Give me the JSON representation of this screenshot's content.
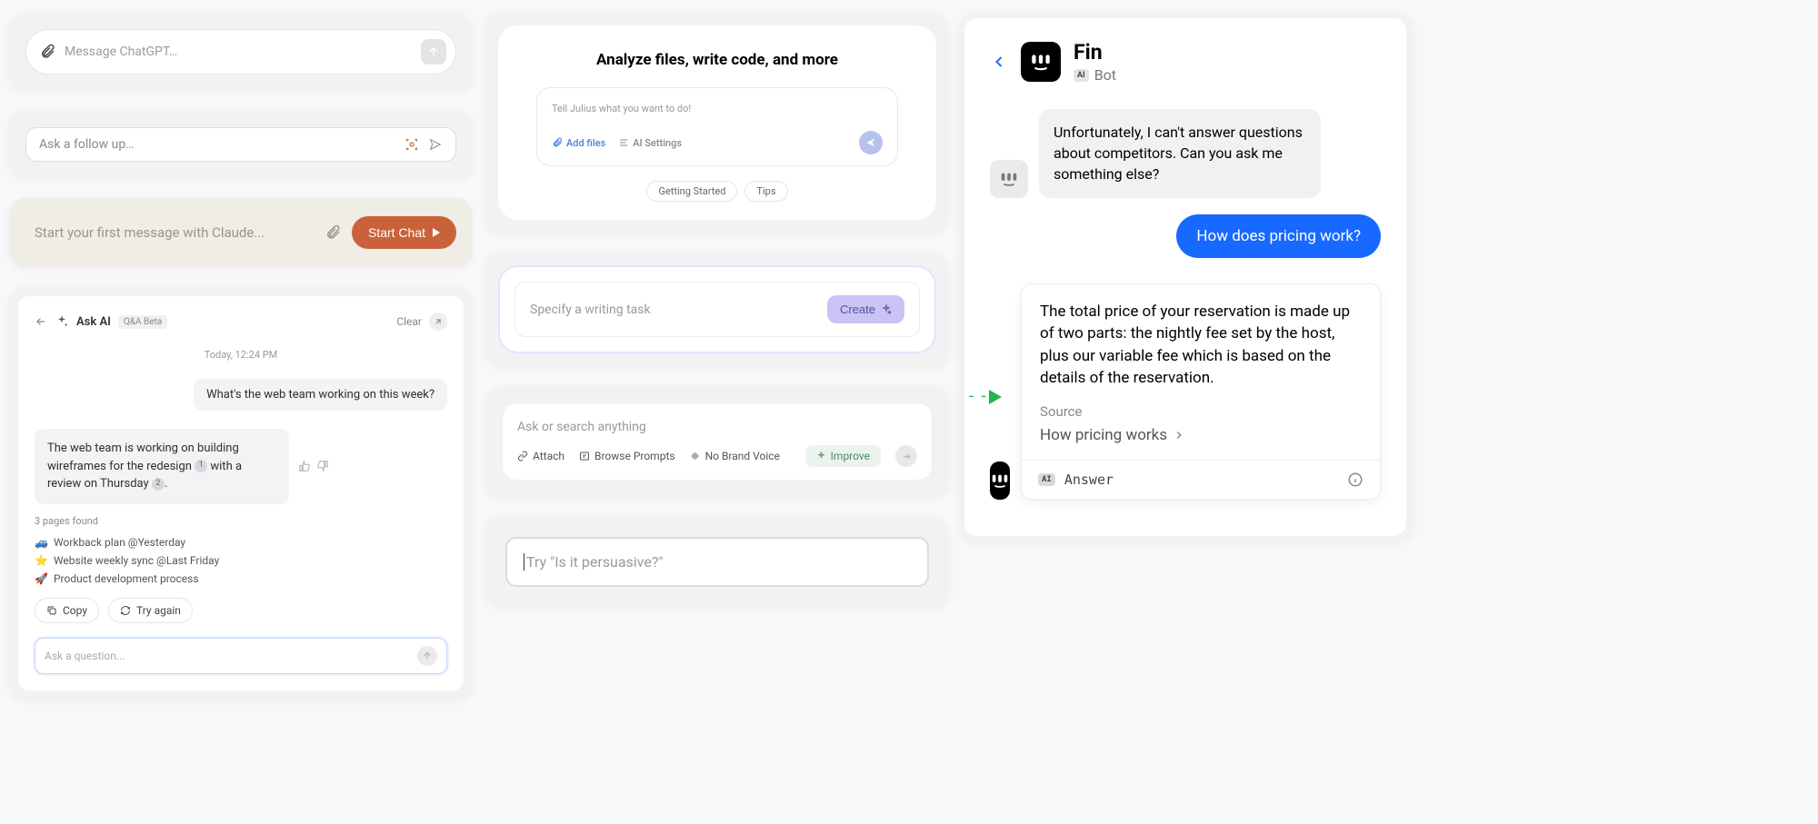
{
  "chatgpt": {
    "placeholder": "Message ChatGPT…"
  },
  "followup": {
    "placeholder": "Ask a follow up…"
  },
  "claude": {
    "placeholder": "Start your first message with Claude...",
    "button": "Start Chat"
  },
  "askai": {
    "title": "Ask AI",
    "badge": "Q&A Beta",
    "clear": "Clear",
    "timestamp": "Today, 12:24 PM",
    "question": "What's the web team working on this week?",
    "answer_part1": "The web team is working on building wireframes for the redesign ",
    "answer_ref1": "1",
    "answer_part2": " with a review on Thursday ",
    "answer_ref2": "2",
    "answer_part3": ".",
    "found": "3 pages found",
    "pages": {
      "p1_emoji": "🚙",
      "p1_text": "Workback plan @Yesterday",
      "p2_emoji": "⭐",
      "p2_text": "Website weekly sync @Last Friday",
      "p3_emoji": "🚀",
      "p3_text": "Product development process"
    },
    "copy": "Copy",
    "tryagain": "Try again",
    "input_placeholder": "Ask a question..."
  },
  "julius": {
    "title": "Analyze files, write code, and more",
    "placeholder": "Tell Julius what you want to do!",
    "addfiles": "Add files",
    "settings": "AI Settings",
    "chips": {
      "a": "Getting Started",
      "b": "Tips"
    }
  },
  "writing": {
    "placeholder": "Specify a writing task",
    "button": "Create"
  },
  "search": {
    "placeholder": "Ask or search anything",
    "attach": "Attach",
    "browse": "Browse Prompts",
    "voice": "No Brand Voice",
    "improve": "Improve"
  },
  "persuasive": {
    "placeholder": "Try \"Is it persuasive?\""
  },
  "fin": {
    "name": "Fin",
    "bot": "Bot",
    "msg1": "Unfortunately, I can't answer questions about competitors. Can you ask me something else?",
    "user_msg": "How does pricing work?",
    "answer_body": "The total price of your reservation is made up of two parts: the nightly fee set by the host, plus our variable fee which is based on the details of the reservation.",
    "source_label": "Source",
    "source_link": "How pricing works",
    "answer_label": "Answer",
    "ai_badge": "AI"
  }
}
